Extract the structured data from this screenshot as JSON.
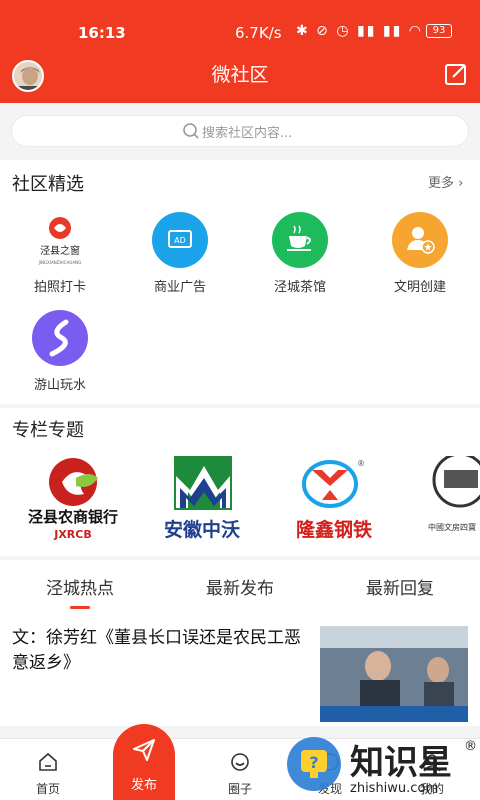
{
  "status_bar": {
    "time": "16:13",
    "net_speed": "6.7K/s",
    "battery": "93"
  },
  "header": {
    "title": "微社区"
  },
  "search": {
    "placeholder": "搜索社区内容..."
  },
  "featured": {
    "title": "社区精选",
    "more": "更多",
    "items": [
      {
        "label": "拍照打卡",
        "icon": "jingxian-window-logo-icon",
        "color": "#e8392a"
      },
      {
        "label": "商业广告",
        "icon": "ad-icon",
        "color": "#1aa3e8"
      },
      {
        "label": "泾城茶馆",
        "icon": "teacup-icon",
        "color": "#1dbb5c"
      },
      {
        "label": "文明创建",
        "icon": "person-star-icon",
        "color": "#f5a530"
      },
      {
        "label": "游山玩水",
        "icon": "river-icon",
        "color": "#7b5cf0"
      }
    ],
    "logo_texts": {
      "window_title": "泾县之窗",
      "window_sub": "JINGXIANZHICHUANG"
    }
  },
  "columns": {
    "title": "专栏专题",
    "logos": [
      {
        "text": "泾县农商银行",
        "sub": "JXRCB",
        "icon": "bank-logo-icon",
        "color": "#c8211e"
      },
      {
        "text": "安徽中沃",
        "icon": "zhongwo-logo-icon",
        "color": "#1f3f8f"
      },
      {
        "text": "隆鑫钢铁",
        "icon": "longxin-logo-icon",
        "color": "#d3201c"
      },
      {
        "text": "中國文房四寶",
        "icon": "ink-logo-icon",
        "color": "#333333"
      }
    ]
  },
  "feed": {
    "tabs": [
      "泾城热点",
      "最新发布",
      "最新回复"
    ],
    "active_tab": 0,
    "article": {
      "title": "文：徐芳红《董县长口误还是农民工恶意返乡》"
    }
  },
  "bottom_nav": {
    "items": [
      {
        "label": "首页",
        "icon": "home-icon"
      },
      {
        "label": "发布",
        "icon": "send-icon"
      },
      {
        "label": "圈子",
        "icon": "circle-icon"
      },
      {
        "label": "发现",
        "icon": "discover-icon"
      },
      {
        "label": "我的",
        "icon": "user-icon"
      }
    ]
  },
  "watermark": {
    "text": "知识星",
    "sub": "zhishiwu.com",
    "mark": "®",
    "q": "?"
  },
  "colors": {
    "accent": "#f03b22"
  }
}
